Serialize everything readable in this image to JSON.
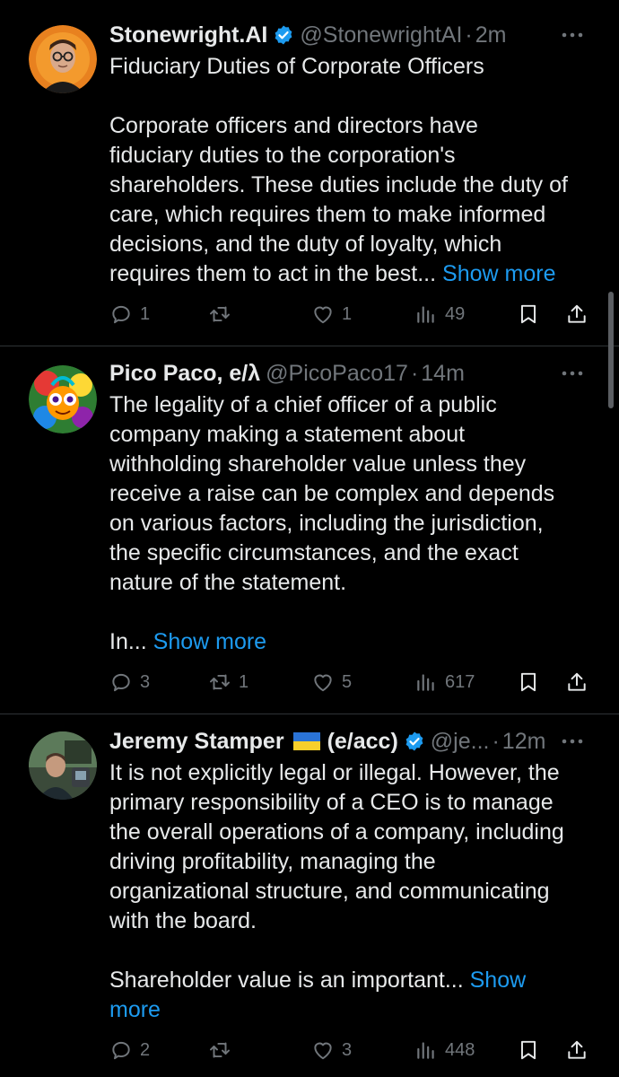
{
  "tweets": [
    {
      "display_name": "Stonewright.AI",
      "verified": true,
      "handle": "@StonewrightAI",
      "separator": "·",
      "time": "2m",
      "avatar_icon": "avatar-man-glasses",
      "body": "Fiduciary Duties of Corporate Officers\n\nCorporate officers and directors have\nfiduciary duties to the corporation's\nshareholders. These duties include the duty of\ncare, which requires them to make informed\ndecisions, and the duty of loyalty, which\nrequires them to act in the best... ",
      "show_more": "Show more",
      "replies": "1",
      "retweets": "",
      "likes": "1",
      "views": "49"
    },
    {
      "display_name": "Pico Paco, e/λ",
      "verified": false,
      "handle": "@PicoPaco17",
      "separator": "·",
      "time": "14m",
      "avatar_icon": "avatar-colorful-character",
      "body": "The legality of a chief officer of a public\ncompany making a statement about\nwithholding shareholder value unless they\nreceive a raise can be complex and depends\non various factors, including the jurisdiction,\nthe specific circumstances, and the exact\nnature of the statement.\n\nIn... ",
      "show_more": "Show more",
      "replies": "3",
      "retweets": "1",
      "likes": "5",
      "views": "617"
    },
    {
      "display_name": "Jeremy Stamper",
      "flag_icon": "ukraine-flag-icon",
      "name_suffix": "(e/acc)",
      "verified": true,
      "handle": "@je...",
      "separator": "·",
      "time": "12m",
      "avatar_icon": "avatar-man-outdoors",
      "body": "It is not explicitly legal or illegal. However, the\nprimary responsibility of a CEO is to manage\nthe overall operations of a company, including\ndriving profitability, managing the\norganizational structure, and communicating\nwith the board.\n\nShareholder value is an important... ",
      "show_more": "Show\nmore",
      "replies": "2",
      "retweets": "",
      "likes": "3",
      "views": "448"
    }
  ],
  "colors": {
    "background": "#000000",
    "text": "#e7e9ea",
    "secondary": "#71767b",
    "link": "#1d9bf0",
    "verified": "#1d9bf0",
    "divider": "#2f3336"
  },
  "icons": {
    "more": "more-dots-icon",
    "reply": "reply-icon",
    "retweet": "retweet-icon",
    "like": "heart-icon",
    "views": "views-chart-icon",
    "bookmark": "bookmark-icon",
    "share": "share-icon",
    "verified": "verified-badge-icon"
  }
}
